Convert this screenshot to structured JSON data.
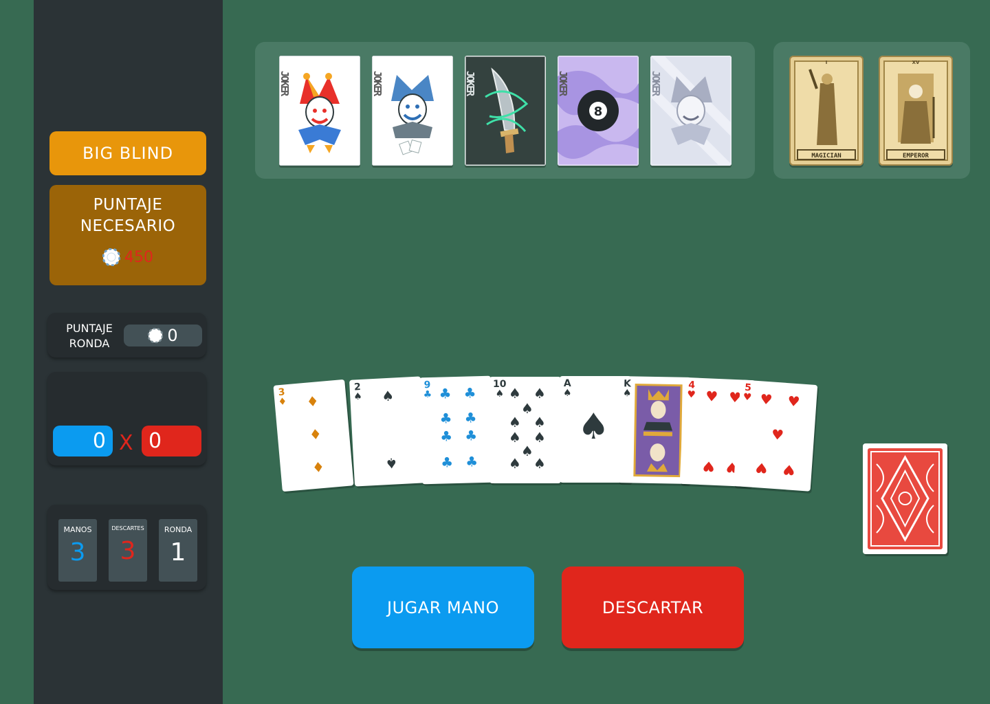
{
  "blind": {
    "title": "BIG BLIND"
  },
  "score_required": {
    "label_line1": "PUNTAJE",
    "label_line2": "NECESARIO",
    "value": "450",
    "value_color": "#e0261c"
  },
  "round_score": {
    "label_line1": "PUNTAJE",
    "label_line2": "RONDA",
    "value": "0"
  },
  "chips_mult": {
    "chips": "0",
    "times": "X",
    "mult": "0"
  },
  "stats": {
    "hands": {
      "label": "MANOS",
      "value": "3"
    },
    "discards": {
      "label": "DESCARTES",
      "value": "3"
    },
    "round": {
      "label": "RONDA",
      "value": "1"
    }
  },
  "jokers": [
    {
      "label": "JOKER",
      "art": "jester-icon"
    },
    {
      "label": "JOKER",
      "art": "blue-jester-icon"
    },
    {
      "label": "JOKER",
      "art": "dagger-icon"
    },
    {
      "label": "JOKER",
      "art": "eight-ball-icon"
    },
    {
      "label": "JOKER",
      "art": "ghost-jester-icon"
    }
  ],
  "tarots": [
    {
      "numeral": "I",
      "name": "MAGICIAN"
    },
    {
      "numeral": "XV",
      "name": "EMPEROR"
    }
  ],
  "hand": [
    {
      "rank": "3",
      "suit": "♦",
      "color": "#d8820c"
    },
    {
      "rank": "2",
      "suit": "♠",
      "color": "#2e3a3d"
    },
    {
      "rank": "9",
      "suit": "♣",
      "color": "#1f8fd8"
    },
    {
      "rank": "10",
      "suit": "♠",
      "color": "#2e3a3d"
    },
    {
      "rank": "A",
      "suit": "♠",
      "color": "#2e3a3d"
    },
    {
      "rank": "K",
      "suit": "♠",
      "color": "#2e3a3d"
    },
    {
      "rank": "4",
      "suit": "♥",
      "color": "#e0261c"
    },
    {
      "rank": "5",
      "suit": "♥",
      "color": "#e0261c"
    }
  ],
  "buttons": {
    "play": "JUGAR MANO",
    "discard": "DESCARTAR"
  },
  "colors": {
    "table": "#376a52",
    "sidebar": "#2b3336",
    "blue": "#0b9bf0",
    "red": "#e0261c",
    "orange": "#e8960b"
  }
}
